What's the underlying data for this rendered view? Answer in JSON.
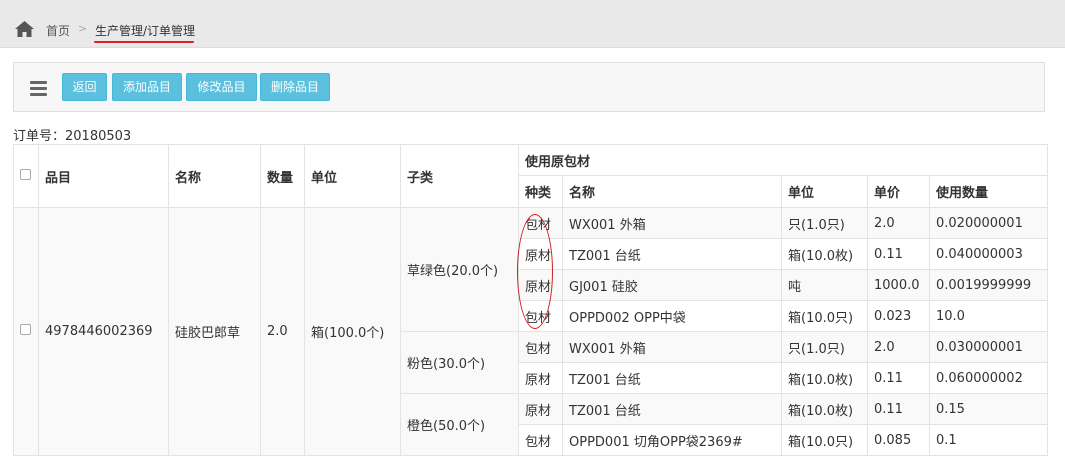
{
  "breadcrumb": {
    "home": "首页",
    "separator": ">",
    "current": "生产管理/订单管理"
  },
  "toolbar": {
    "back": "返回",
    "add": "添加品目",
    "edit": "修改品目",
    "delete": "删除品目"
  },
  "order": {
    "label": "订单号：20180503"
  },
  "table": {
    "group_header": "使用原包材",
    "headers": {
      "item": "品目",
      "name": "名称",
      "qty": "数量",
      "unit": "单位",
      "subtype": "子类",
      "kind": "种类",
      "mat_name": "名称",
      "mat_unit": "单位",
      "price": "单价",
      "usage": "使用数量"
    },
    "product": {
      "item": "4978446002369",
      "name": "硅胶巴郎草",
      "qty": "2.0",
      "unit": "箱(100.0个)"
    },
    "subtypes": [
      "草绿色(20.0个)",
      "粉色(30.0个)",
      "橙色(50.0个)"
    ],
    "rows": [
      {
        "kind": "包材",
        "name": "WX001 外箱",
        "unit": "只(1.0只)",
        "price": "2.0",
        "usage": "0.020000001"
      },
      {
        "kind": "原材",
        "name": "TZ001 台纸",
        "unit": "箱(10.0枚)",
        "price": "0.11",
        "usage": "0.040000003"
      },
      {
        "kind": "原材",
        "name": "GJ001 硅胶",
        "unit": "吨",
        "price": "1000.0",
        "usage": "0.0019999999"
      },
      {
        "kind": "包材",
        "name": "OPPD002 OPP中袋",
        "unit": "箱(10.0只)",
        "price": "0.023",
        "usage": "10.0"
      },
      {
        "kind": "包材",
        "name": "WX001 外箱",
        "unit": "只(1.0只)",
        "price": "2.0",
        "usage": "0.030000001"
      },
      {
        "kind": "原材",
        "name": "TZ001 台纸",
        "unit": "箱(10.0枚)",
        "price": "0.11",
        "usage": "0.060000002"
      },
      {
        "kind": "原材",
        "name": "TZ001 台纸",
        "unit": "箱(10.0枚)",
        "price": "0.11",
        "usage": "0.15"
      },
      {
        "kind": "包材",
        "name": "OPPD001 切角OPP袋2369#",
        "unit": "箱(10.0只)",
        "price": "0.085",
        "usage": "0.1"
      }
    ]
  },
  "colors": {
    "button": "#5bc0de",
    "annotation": "#d42020",
    "underline": "#e02020"
  }
}
